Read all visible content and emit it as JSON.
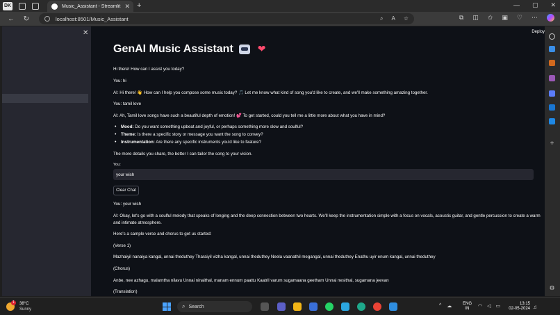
{
  "browser": {
    "profile_label": "DK",
    "tab_title": "Music_Assistant - Streamlit",
    "url": "localhost:8501/Music_Assistant"
  },
  "app": {
    "deploy_label": "Deploy",
    "title": "GenAI Music Assistant",
    "messages": [
      {
        "text": "Hi there! How can I assist you today?"
      },
      {
        "text": "You: hi"
      },
      {
        "text": "AI: Hi there! 👋 How can I help you compose some music today? 🎵 Let me know what kind of song you'd like to create, and we'll make something amazing together."
      },
      {
        "text": "You: tamil love"
      },
      {
        "text": "AI: Ah, Tamil love songs have such a beautiful depth of emotion! 💕 To get started, could you tell me a little more about what you have in mind?"
      }
    ],
    "bullets": [
      {
        "label": "Mood:",
        "text": " Do you want something upbeat and joyful, or perhaps something more slow and soulful?"
      },
      {
        "label": "Theme:",
        "text": " Is there a specific story or message you want the song to convey?"
      },
      {
        "label": "Instrumentation:",
        "text": " Are there any specific instruments you'd like to feature?"
      }
    ],
    "closing": "The more details you share, the better I can tailor the song to your vision.",
    "input_label": "You:",
    "input_value": "your wish",
    "clear_button": "Clear Chat",
    "after": [
      {
        "text": "You: your wish"
      },
      {
        "text": "AI: Okay, let's go with a soulful melody that speaks of longing and the deep connection between two hearts. We'll keep the instrumentation simple with a focus on vocals, acoustic guitar, and gentle percussion to create a warm"
      },
      {
        "text": "and intimate atmosphere."
      },
      {
        "text": "Here's a sample verse and chorus to get us started:"
      },
      {
        "text": "(Verse 1)"
      },
      {
        "text": "Mazhaiyil nanaiya kangal, unnai theduthey Tharaiyil vizha kangal, unnai theduthey Neela vaanathil megangal, unnai theduthey Enathu uyir enum kangal, unnai theduthey"
      },
      {
        "text": "(Chorus)"
      },
      {
        "text": "Anbe, nee azhagu, malarntha nilavu Unnai ninaithal, manam ennum paattu Kaatril varum sugamaana geetham Unnai nesithal, sugamana jeevan"
      },
      {
        "text": "(Translation)"
      }
    ]
  },
  "taskbar": {
    "temperature": "38°C",
    "condition": "Sunny",
    "weather_badge": "1",
    "search_placeholder": "Search",
    "lang_line1": "ENG",
    "lang_line2": "IN",
    "time": "13:15",
    "date": "02-05-2024"
  }
}
